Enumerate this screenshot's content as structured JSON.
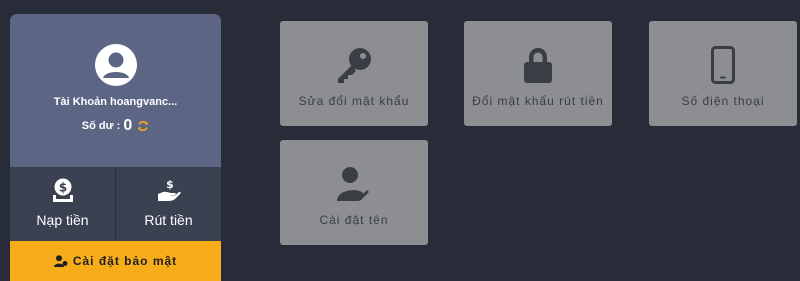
{
  "account": {
    "name": "Tài Khoản hoangvanc...",
    "balance_label": "Số dư :",
    "balance_value": "0"
  },
  "actions": {
    "deposit_label": "Nạp tiền",
    "withdraw_label": "Rút tiền"
  },
  "security": {
    "label": "Cài đặt bảo mật"
  },
  "tiles": [
    {
      "label": "Sửa đổi mật khẩu",
      "icon": "key-icon"
    },
    {
      "label": "Đổi mật khẩu rút tiền",
      "icon": "lock-icon"
    },
    {
      "label": "Số điện thoại",
      "icon": "phone-icon"
    },
    {
      "label": "Cài đặt tên",
      "icon": "user-edit-icon"
    }
  ],
  "colors": {
    "background": "#282c39",
    "account_header": "#5c6584",
    "action_bg": "#3a4151",
    "accent": "#f7ac1a",
    "tile_bg": "#8c8e92",
    "tile_icon": "#3a3d44"
  }
}
